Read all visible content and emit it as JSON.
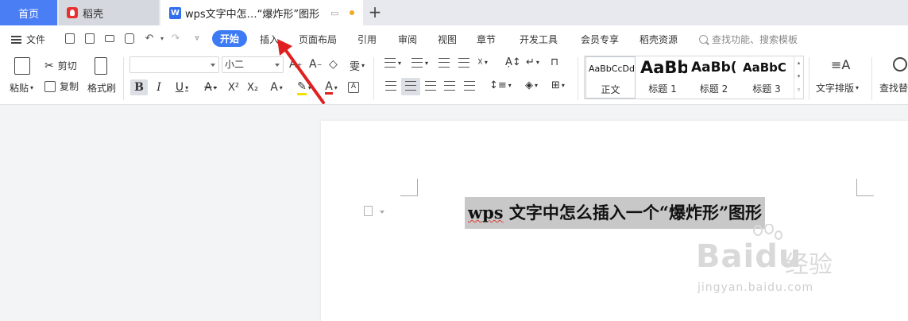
{
  "tabs": {
    "home": "首页",
    "daoke": "稻壳",
    "doc_title": "wps文字中怎…“爆炸形”图形",
    "new_tab": "+"
  },
  "menu": {
    "file": "文件",
    "start": "开始",
    "items": [
      "插入",
      "页面布局",
      "引用",
      "审阅",
      "视图",
      "章节",
      "开发工具",
      "会员专享",
      "稻壳资源"
    ],
    "search_placeholder": "查找功能、搜索模板"
  },
  "ribbon": {
    "paste": "粘贴",
    "cut": "剪切",
    "copy": "复制",
    "format_painter": "格式刷",
    "font_name": "",
    "font_size": "小二",
    "styles": [
      {
        "sample": "AaBbCcDd",
        "label": "正文"
      },
      {
        "sample": "AaBb",
        "label": "标题 1"
      },
      {
        "sample": "AaBb(",
        "label": "标题 2"
      },
      {
        "sample": "AaBbC",
        "label": "标题 3"
      }
    ],
    "text_layout": "文字排版",
    "find_replace": "查找替"
  },
  "document": {
    "heading_wps": "wps",
    "heading_rest": " 文字中怎么插入一个“爆炸形”图形"
  },
  "watermark": {
    "brand": "Baidu",
    "brand_cn": "经验",
    "url": "jingyan.baidu.com"
  },
  "colors": {
    "accent": "#3c7bf5",
    "home_tab": "#4a7ef5",
    "arrow": "#e02020",
    "highlight": "#c8c8c8"
  }
}
